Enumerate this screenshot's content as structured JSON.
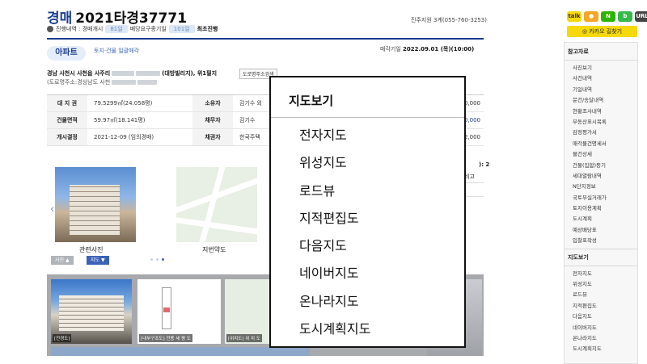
{
  "header": {
    "kind": "경매",
    "case_no": "2021타경37771",
    "court": "진주지원 3계(055-760-3253)",
    "status_prefix": "진행내역 : 경매개시",
    "status_days1": "81일",
    "status_middle": "배당요구종기일",
    "status_days2": "101일",
    "status_end": "최초진행"
  },
  "property": {
    "type_badge": "아파트",
    "type_link": "토지·건물 일괄매각",
    "sale_date_label": "매각기일",
    "sale_date": "2022.09.01 (목)(10:00)",
    "address_start": "경남 사천시 사천읍 사주리",
    "address_end": "(대방빌리지), 위1필지",
    "address_button": "도로명주소검색",
    "road_address_prefix": "(도로명주소:경상남도 사천"
  },
  "info_rows": [
    {
      "h1": "대 지 권",
      "v1": "79.5299㎡(24.058평)",
      "h2": "소유자",
      "v2": "김기수 외",
      "v3": "0,000",
      "blue": false
    },
    {
      "h1": "건물면적",
      "v1": "59.97㎡(18.141평)",
      "h2": "채무자",
      "v2": "김기수",
      "v3": "0,000",
      "blue": true
    },
    {
      "h1": "개시결정",
      "v1": "2021-12-09 (임의경매)",
      "h2": "채권자",
      "v2": "한국주택",
      "v3": "2,000",
      "blue": false
    }
  ],
  "photos": {
    "caption1": "관련사진",
    "caption2": "지번약도",
    "btn_photo": "사진 ▲",
    "btn_map": "지도 ▼",
    "side_a": "): 2",
    "side_b": "비고"
  },
  "gallery": {
    "label1": "[전경도]",
    "label2": "[내부구조도] 전용 세 평 도",
    "label3": "[위치도] 위 치 도"
  },
  "map_popup": {
    "title": "지도보기",
    "items": [
      "전자지도",
      "위성지도",
      "로드뷰",
      "지적편집도",
      "다음지도",
      "네이버지도",
      "온나라지도",
      "도시계획지도"
    ]
  },
  "sidebar": {
    "sns": [
      "talk",
      "story",
      "N",
      "band",
      "URL"
    ],
    "kakao_button": "카카오 길찾기",
    "section1_title": "참고자료",
    "section1_items": [
      "사진보기",
      "사건내역",
      "기일내역",
      "문건/송달내역",
      "현황조사내역",
      "부동산표시목록",
      "감정평가서",
      "매각물건명세서",
      "물건상세",
      "건물(집합)등기",
      "세대열람내역",
      "N단지정보",
      "국토부실거래가",
      "토지이용계획",
      "도시계획",
      "예상배당표",
      "입찰표작성"
    ],
    "section2_title": "지도보기",
    "section2_items": [
      "전자지도",
      "위성지도",
      "로드뷰",
      "지적편집도",
      "다음지도",
      "네이버지도",
      "온나라지도",
      "도시계획지도"
    ]
  }
}
